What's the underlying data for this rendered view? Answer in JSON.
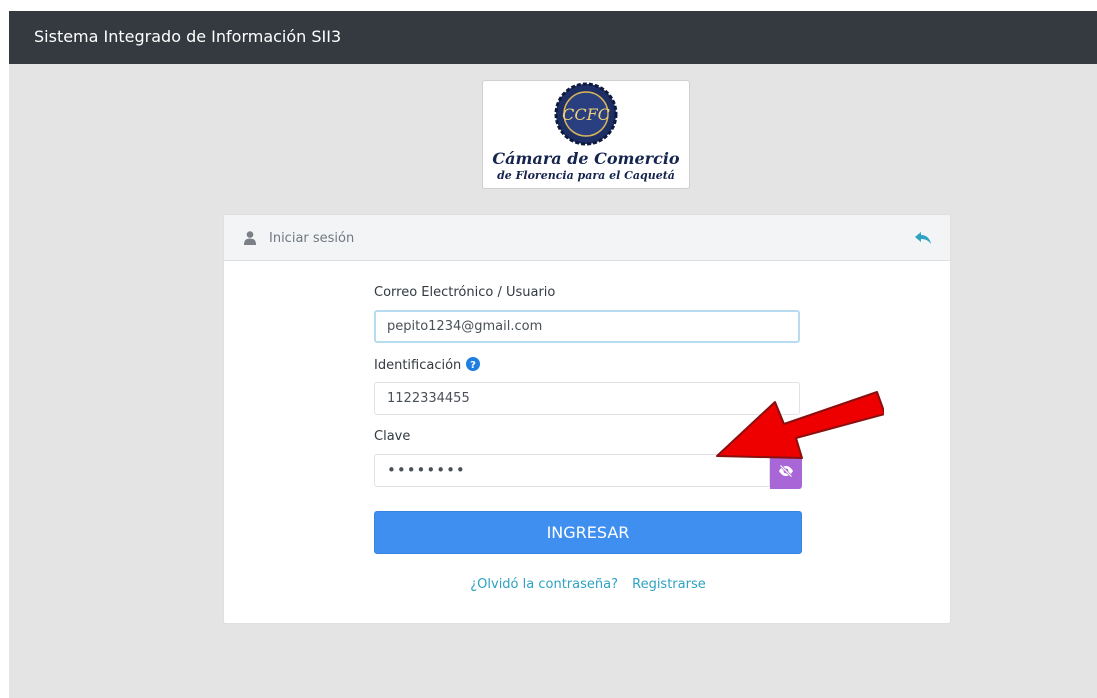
{
  "app": {
    "title": "Sistema Integrado de Información SII3"
  },
  "logo": {
    "monogram": "CCFC",
    "line1": "Cámara de Comercio",
    "line2": "de Florencia para el Caquetá"
  },
  "login": {
    "header": "Iniciar sesión",
    "email_label": "Correo Electrónico / Usuario",
    "email_value": "pepito1234@gmail.com",
    "id_label": "Identificación",
    "id_value": "1122334455",
    "password_label": "Clave",
    "password_value": "••••••••",
    "submit_label": "INGRESAR",
    "forgot_link": "¿Olvidó la contraseña?",
    "register_link": "Registrarse"
  },
  "colors": {
    "topbar": "#343a40",
    "primary": "#3f8ff0",
    "link": "#2da2c2",
    "eye_button": "#a866d6",
    "arrow": "#ee0000"
  },
  "icons": [
    "user-icon",
    "reply-icon",
    "question-circle-icon",
    "eye-slash-icon",
    "annotation-arrow"
  ]
}
